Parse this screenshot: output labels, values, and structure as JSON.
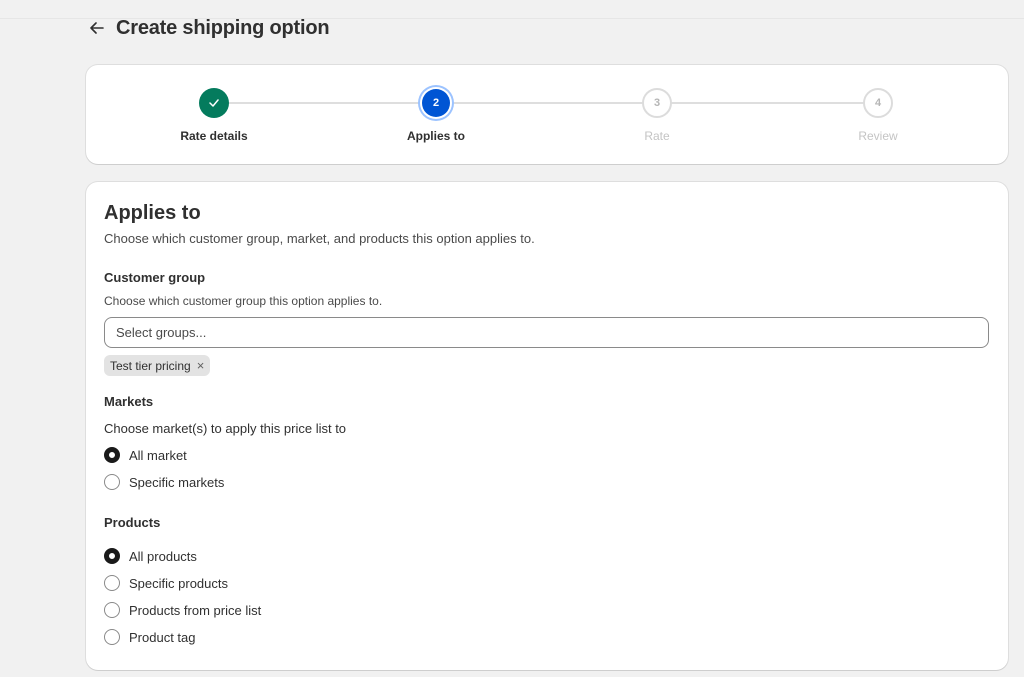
{
  "page": {
    "title": "Create shipping option",
    "back_icon": "arrow-left-icon"
  },
  "stepper": {
    "steps": [
      {
        "number": "1",
        "label": "Rate details",
        "state": "done"
      },
      {
        "number": "2",
        "label": "Applies to",
        "state": "current"
      },
      {
        "number": "3",
        "label": "Rate",
        "state": "upcoming"
      },
      {
        "number": "4",
        "label": "Review",
        "state": "upcoming"
      }
    ]
  },
  "applies_to": {
    "title": "Applies to",
    "description": "Choose which customer group, market, and products this option applies to.",
    "customer_group": {
      "label": "Customer group",
      "help": "Choose which customer group this option applies to.",
      "placeholder": "Select groups...",
      "selected_tags": [
        "Test tier pricing"
      ]
    },
    "markets": {
      "label": "Markets",
      "prompt": "Choose market(s) to apply this price list to",
      "options": [
        {
          "label": "All market",
          "checked": true
        },
        {
          "label": "Specific markets",
          "checked": false
        }
      ]
    },
    "products": {
      "label": "Products",
      "options": [
        {
          "label": "All products",
          "checked": true
        },
        {
          "label": "Specific products",
          "checked": false
        },
        {
          "label": "Products from price list",
          "checked": false
        },
        {
          "label": "Product tag",
          "checked": false
        }
      ]
    }
  },
  "colors": {
    "done": "#047b5d",
    "current": "#0055d4",
    "background": "#f1f1f1"
  }
}
